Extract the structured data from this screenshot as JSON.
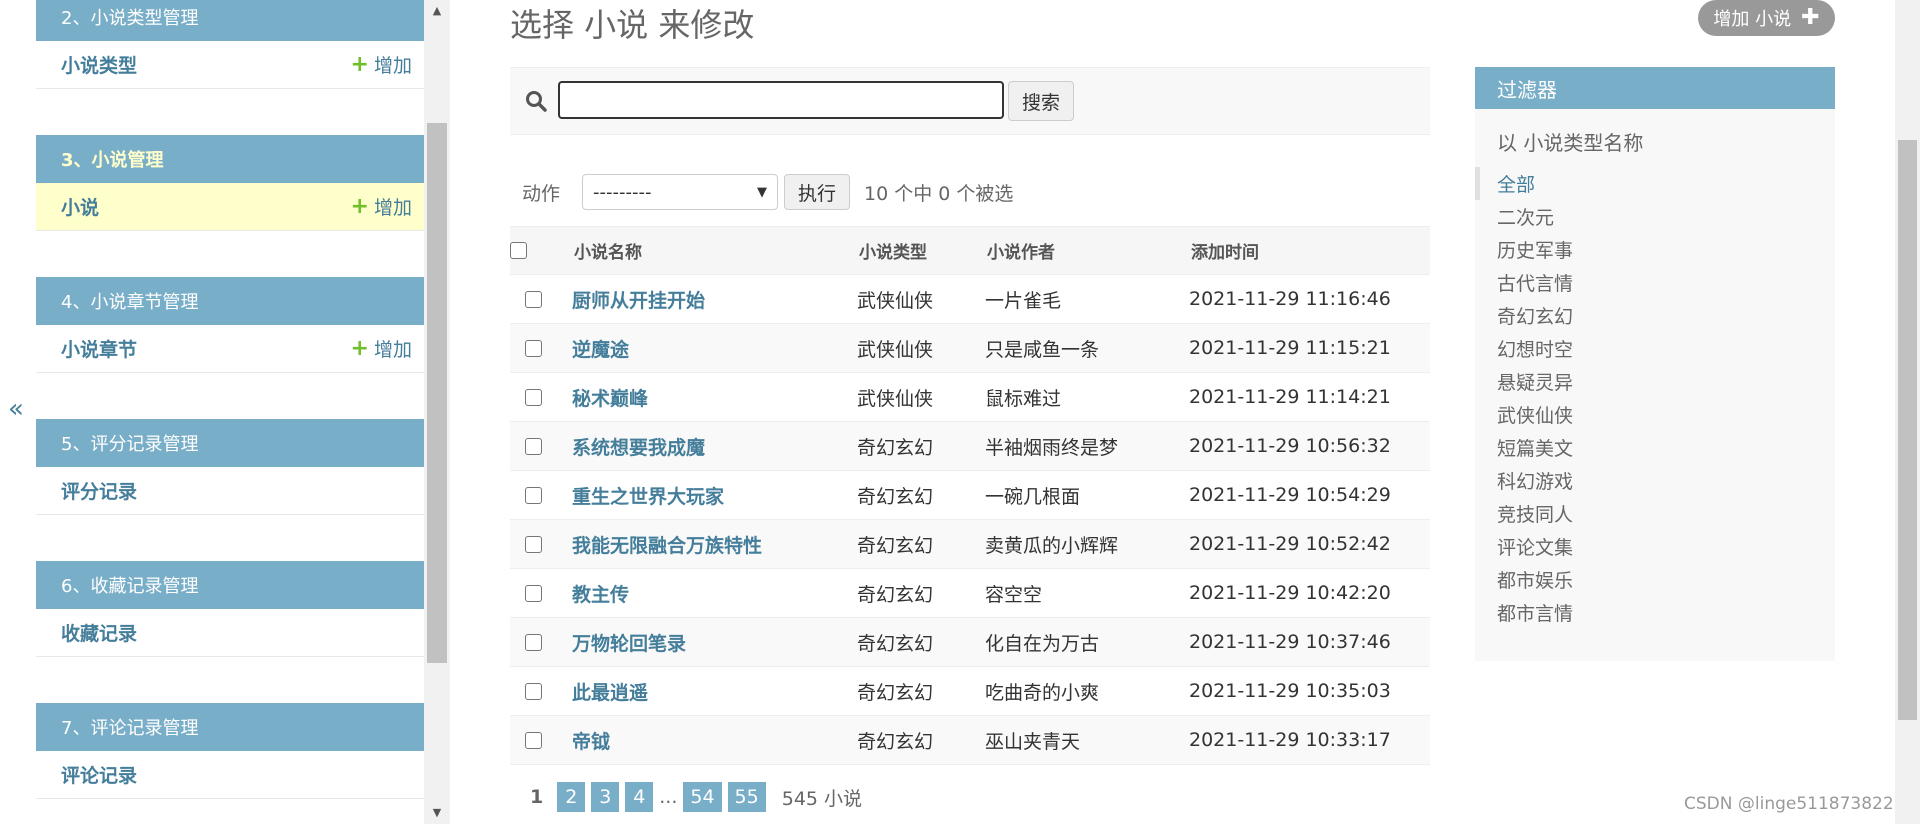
{
  "nav_toggle": "«",
  "sidebar": {
    "modules": [
      {
        "header": "2、小说类型管理",
        "item": "小说类型",
        "add": "增加",
        "current": false
      },
      {
        "header": "3、小说管理",
        "item": "小说",
        "add": "增加",
        "current": true
      },
      {
        "header": "4、小说章节管理",
        "item": "小说章节",
        "add": "增加",
        "current": false
      },
      {
        "header": "5、评分记录管理",
        "item": "评分记录",
        "add": null,
        "current": false
      },
      {
        "header": "6、收藏记录管理",
        "item": "收藏记录",
        "add": null,
        "current": false
      },
      {
        "header": "7、评论记录管理",
        "item": "评论记录",
        "add": null,
        "current": false
      }
    ]
  },
  "header": {
    "title": "选择 小说 来修改",
    "add_button": "增加 小说"
  },
  "search": {
    "value": "",
    "button": "搜索"
  },
  "actions": {
    "label": "动作",
    "selected": "---------",
    "run": "执行",
    "counter": "10 个中 0 个被选"
  },
  "table": {
    "columns": [
      "小说名称",
      "小说类型",
      "小说作者",
      "添加时间"
    ],
    "rows": [
      {
        "name": "厨师从开挂开始",
        "type": "武侠仙侠",
        "author": "一片雀毛",
        "date": "2021-11-29 11:16:46"
      },
      {
        "name": "逆魔途",
        "type": "武侠仙侠",
        "author": "只是咸鱼一条",
        "date": "2021-11-29 11:15:21"
      },
      {
        "name": "秘术巅峰",
        "type": "武侠仙侠",
        "author": "鼠标难过",
        "date": "2021-11-29 11:14:21"
      },
      {
        "name": "系统想要我成魔",
        "type": "奇幻玄幻",
        "author": "半袖烟雨终是梦",
        "date": "2021-11-29 10:56:32"
      },
      {
        "name": "重生之世界大玩家",
        "type": "奇幻玄幻",
        "author": "一碗几根面",
        "date": "2021-11-29 10:54:29"
      },
      {
        "name": "我能无限融合万族特性",
        "type": "奇幻玄幻",
        "author": "卖黄瓜的小辉辉",
        "date": "2021-11-29 10:52:42"
      },
      {
        "name": "教主传",
        "type": "奇幻玄幻",
        "author": "容空空",
        "date": "2021-11-29 10:42:20"
      },
      {
        "name": "万物轮回笔录",
        "type": "奇幻玄幻",
        "author": "化自在为万古",
        "date": "2021-11-29 10:37:46"
      },
      {
        "name": "此最逍遥",
        "type": "奇幻玄幻",
        "author": "吃曲奇的小爽",
        "date": "2021-11-29 10:35:03"
      },
      {
        "name": "帝钺",
        "type": "奇幻玄幻",
        "author": "巫山夹青天",
        "date": "2021-11-29 10:33:17"
      }
    ]
  },
  "paginator": {
    "current": "1",
    "pages": [
      "2",
      "3",
      "4"
    ],
    "ellipsis": "...",
    "last_pages": [
      "54",
      "55"
    ],
    "total": "545 小说"
  },
  "filter": {
    "title": "过滤器",
    "subtitle": "以 小说类型名称",
    "options": [
      "全部",
      "二次元",
      "历史军事",
      "古代言情",
      "奇幻玄幻",
      "幻想时空",
      "悬疑灵异",
      "武侠仙侠",
      "短篇美文",
      "科幻游戏",
      "竞技同人",
      "评论文集",
      "都市娱乐",
      "都市言情"
    ],
    "selected_index": 0
  },
  "watermark": "CSDN @linge511873822",
  "colors": {
    "header_blue": "#79aec8",
    "link_blue": "#447e9b",
    "current_yellow": "#ffffcc",
    "add_green": "#70bf2b"
  }
}
